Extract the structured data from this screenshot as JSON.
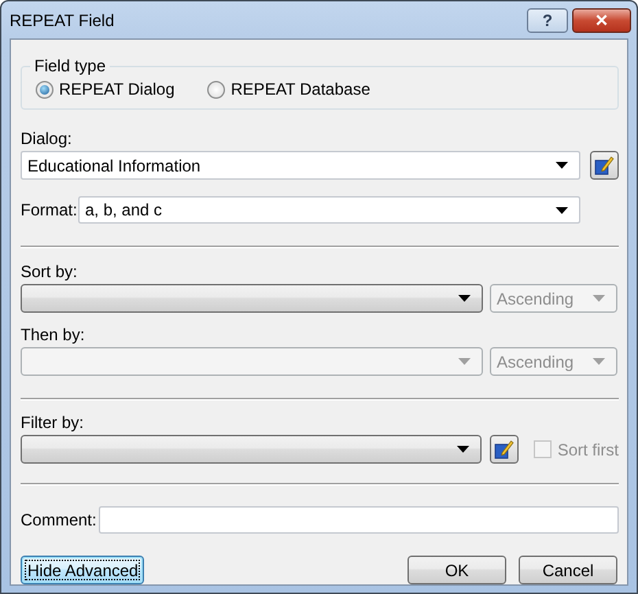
{
  "window": {
    "title": "REPEAT Field",
    "help_glyph": "?",
    "close_glyph": "✕"
  },
  "field_type": {
    "legend": "Field type",
    "options": [
      {
        "label": "REPEAT Dialog",
        "selected": true
      },
      {
        "label": "REPEAT Database",
        "selected": false
      }
    ]
  },
  "dialog": {
    "label": "Dialog:",
    "combo": {
      "kind": "editable",
      "value": "Educational Information",
      "disabled": false
    }
  },
  "format": {
    "label": "Format:",
    "combo": {
      "kind": "editable",
      "value": "a, b, and c",
      "disabled": false
    }
  },
  "sort_by": {
    "label": "Sort by:",
    "field": {
      "kind": "list",
      "disabled": false
    },
    "order": {
      "kind": "list",
      "value": "Ascending",
      "disabled": true
    }
  },
  "then_by": {
    "label": "Then by:",
    "field": {
      "kind": "list",
      "disabled": true
    },
    "order": {
      "kind": "list",
      "value": "Ascending",
      "disabled": true
    }
  },
  "filter_by": {
    "label": "Filter by:",
    "field": {
      "kind": "list",
      "disabled": false
    },
    "sort_first": {
      "label": "Sort first",
      "checked": false,
      "disabled": true
    }
  },
  "comment": {
    "label": "Comment:"
  },
  "buttons": [
    {
      "label": "Hide Advanced",
      "focused": true
    },
    {
      "label": "OK",
      "focused": false
    },
    {
      "label": "Cancel",
      "focused": false
    }
  ]
}
